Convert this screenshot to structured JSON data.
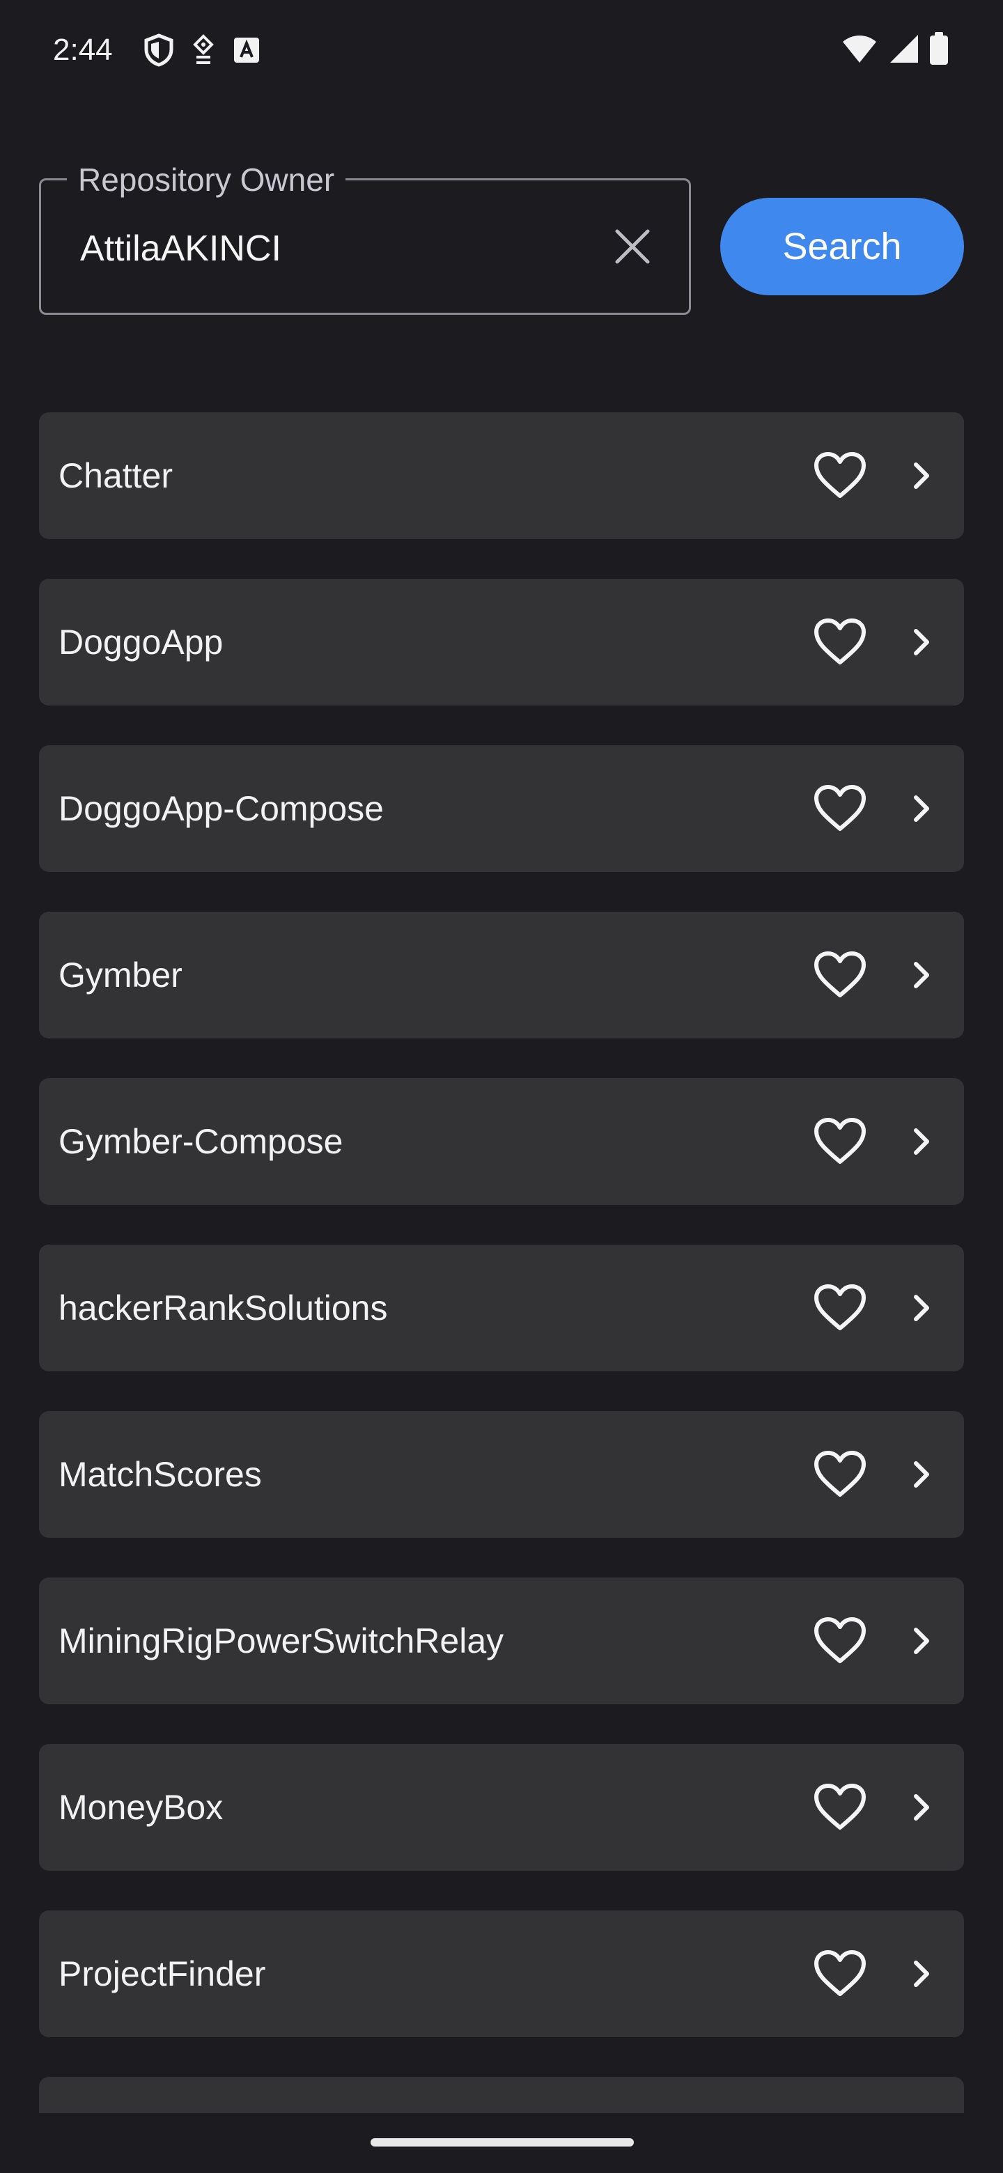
{
  "status_bar": {
    "time": "2:44",
    "icons_left": [
      "shield-icon",
      "vpn-key-icon",
      "font-a-icon"
    ],
    "icons_right": [
      "wifi-icon",
      "signal-icon",
      "battery-icon"
    ]
  },
  "search": {
    "label": "Repository Owner",
    "value": "AttilaAKINCI",
    "clear_icon": "close-icon",
    "button_label": "Search",
    "button_color": "#3f88ee"
  },
  "repositories": [
    {
      "name": "Chatter"
    },
    {
      "name": "DoggoApp"
    },
    {
      "name": "DoggoApp-Compose"
    },
    {
      "name": "Gymber"
    },
    {
      "name": "Gymber-Compose"
    },
    {
      "name": "hackerRankSolutions"
    },
    {
      "name": "MatchScores"
    },
    {
      "name": "MiningRigPowerSwitchRelay"
    },
    {
      "name": "MoneyBox"
    },
    {
      "name": "ProjectFinder"
    },
    {
      "name": ""
    }
  ],
  "item_icons": {
    "favorite": "heart-outline-icon",
    "open": "chevron-right-icon"
  },
  "colors": {
    "background": "#1c1b20",
    "card": "#333336",
    "accent": "#3f88ee"
  }
}
